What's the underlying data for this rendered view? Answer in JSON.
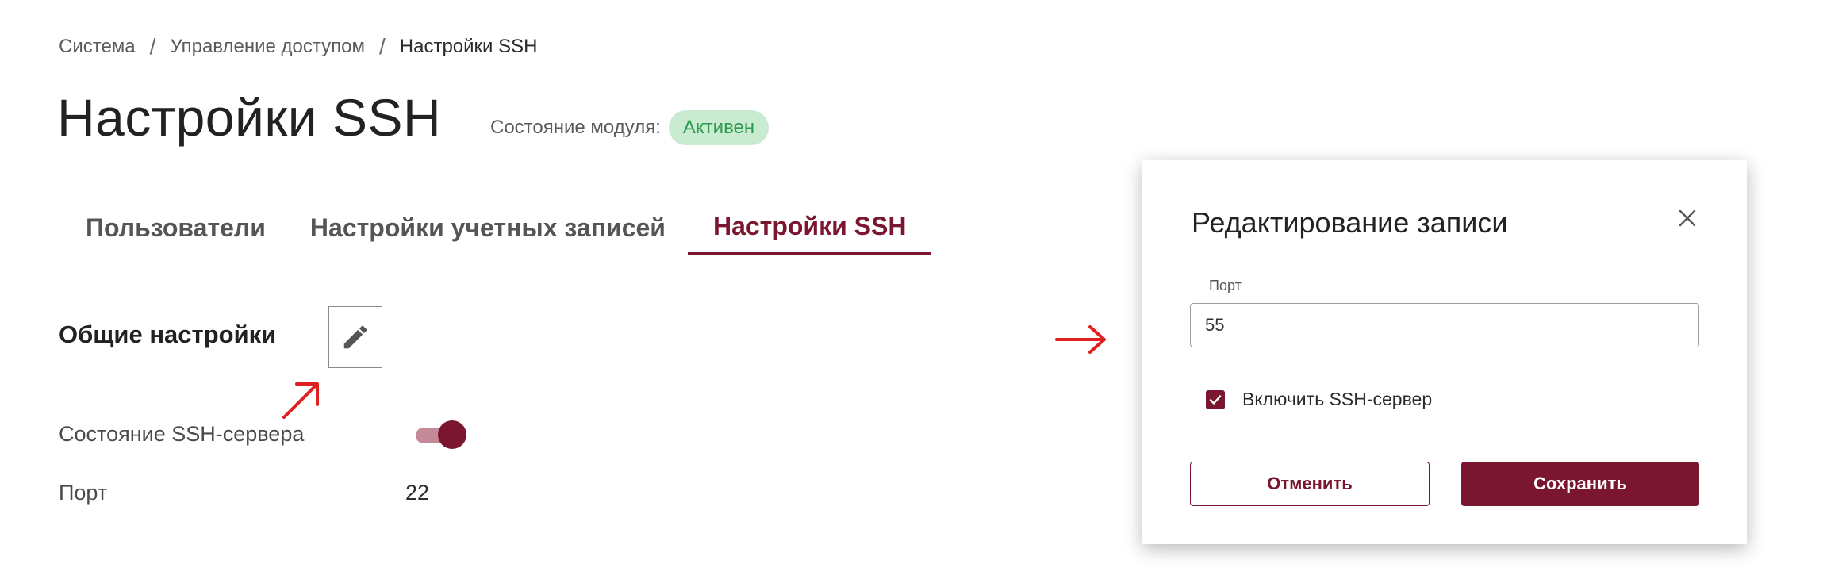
{
  "breadcrumb": {
    "items": [
      "Система",
      "Управление доступом",
      "Настройки SSH"
    ],
    "separator": "/"
  },
  "page": {
    "title": "Настройки SSH",
    "module_state_label": "Состояние модуля:",
    "module_state_value": "Активен"
  },
  "tabs": [
    {
      "label": "Пользователи",
      "active": false
    },
    {
      "label": "Настройки учетных записей",
      "active": false
    },
    {
      "label": "Настройки SSH",
      "active": true
    }
  ],
  "section": {
    "title": "Общие настройки",
    "edit_icon": "pencil-icon",
    "rows": [
      {
        "label": "Состояние SSH-сервера",
        "value_type": "toggle",
        "value": true
      },
      {
        "label": "Порт",
        "value": "22"
      }
    ]
  },
  "modal": {
    "title": "Редактирование записи",
    "close_icon": "close-icon",
    "port_label": "Порт",
    "port_value": "55",
    "checkbox_label": "Включить SSH-сервер",
    "checkbox_checked": true,
    "cancel_label": "Отменить",
    "save_label": "Сохранить"
  },
  "colors": {
    "accent": "#7a1630",
    "annotation_arrow": "#e02020",
    "badge_bg": "#c9ecd1",
    "badge_text": "#2e9a4e"
  }
}
